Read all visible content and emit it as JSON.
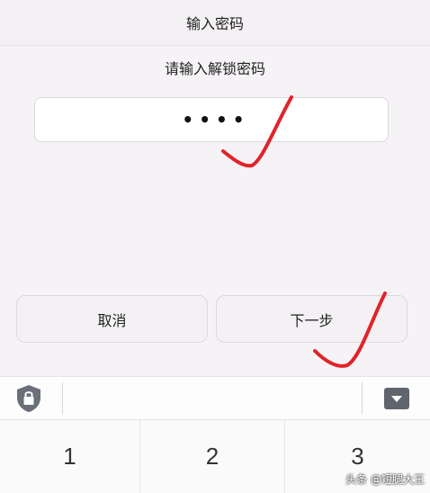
{
  "header": {
    "title": "输入密码"
  },
  "prompt": {
    "text": "请输入解锁密码"
  },
  "password": {
    "masked_value": "••••"
  },
  "buttons": {
    "cancel": "取消",
    "next": "下一步"
  },
  "keyboard": {
    "toolbar_icons": [
      "lock-icon",
      "keyboard-hide-icon"
    ],
    "keys": [
      "1",
      "2",
      "3"
    ]
  },
  "watermark": {
    "text": "头条 @短腿大王"
  },
  "colors": {
    "annotation_red": "#e0242a",
    "background": "#f6f3f6"
  }
}
